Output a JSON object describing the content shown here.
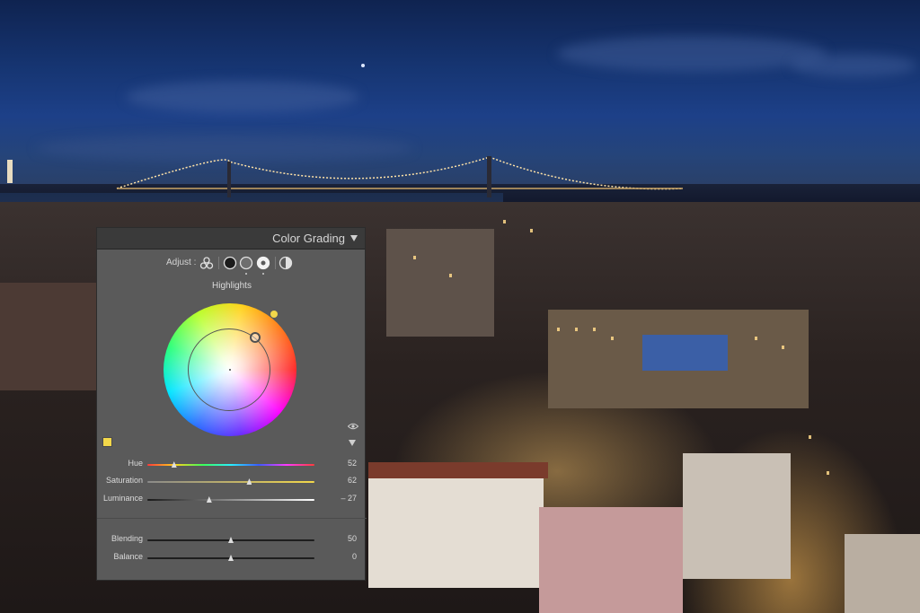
{
  "panel": {
    "title": "Color Grading",
    "adjust_label": "Adjust :",
    "mode_icons": [
      "three-way-icon",
      "shadows-icon",
      "midtones-icon",
      "highlights-icon",
      "global-icon"
    ],
    "section_label": "Highlights"
  },
  "wheel": {
    "hue_deg": 52,
    "saturation": 62,
    "swatch_color": "#f3d84a"
  },
  "sliders": [
    {
      "label": "Hue",
      "value": "52",
      "position": 0.16,
      "track": "hue"
    },
    {
      "label": "Saturation",
      "value": "62",
      "position": 0.61,
      "track": "sat"
    },
    {
      "label": "Luminance",
      "value": "– 27",
      "position": 0.37,
      "track": "lum"
    }
  ],
  "blend_sliders": [
    {
      "label": "Blending",
      "value": "50",
      "position": 0.5
    },
    {
      "label": "Balance",
      "value": "0",
      "position": 0.5
    }
  ],
  "colors": {
    "panel_bg": "#5a5a5a",
    "header_bg": "#3a3a3a",
    "accent": "#f3d84a"
  }
}
